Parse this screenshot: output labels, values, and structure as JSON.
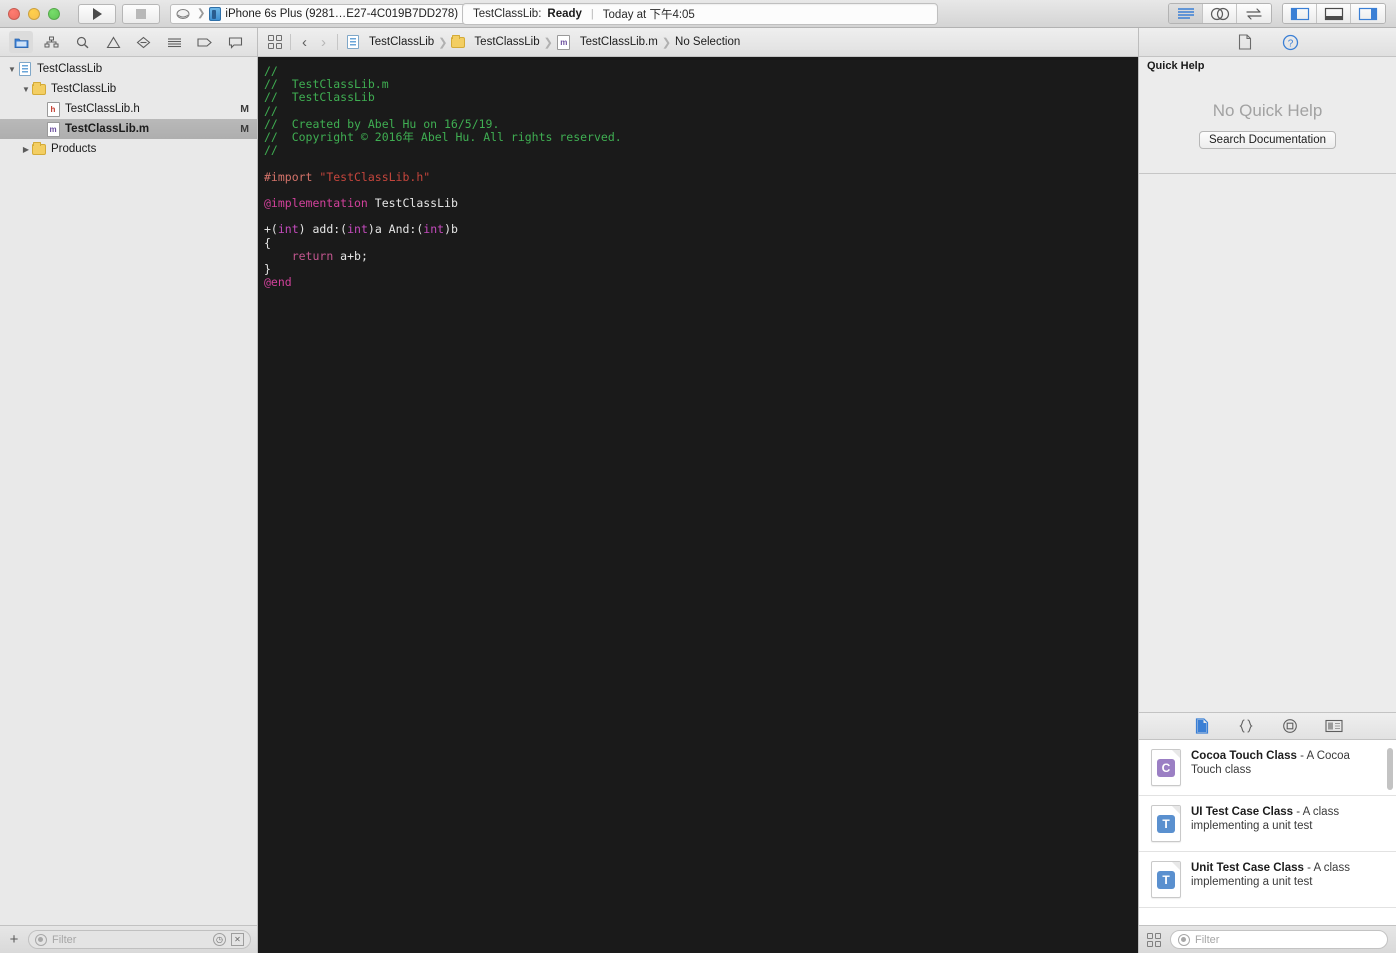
{
  "window": {
    "traffic_lights": [
      "close",
      "minimize",
      "zoom"
    ]
  },
  "toolbar": {
    "run_label": "Run",
    "stop_label": "Stop",
    "scheme": {
      "target": "TestClassLib",
      "destination": "iPhone 6s Plus (9281…E27-4C019B7DD278)"
    },
    "status": {
      "project": "TestClassLib:",
      "state": "Ready",
      "separator": "|",
      "time": "Today at 下午4:05"
    },
    "editor_modes": [
      {
        "name": "standard-editor",
        "selected": true
      },
      {
        "name": "assistant-editor",
        "selected": false
      },
      {
        "name": "version-editor",
        "selected": false
      }
    ],
    "view_toggles": [
      {
        "name": "navigator-toggle",
        "selected": true
      },
      {
        "name": "debug-area-toggle",
        "selected": false
      },
      {
        "name": "utilities-toggle",
        "selected": true
      }
    ]
  },
  "navigator": {
    "tabs": [
      {
        "name": "project-navigator",
        "icon": "folder-icon",
        "selected": true
      },
      {
        "name": "symbol-navigator",
        "icon": "hierarchy-icon",
        "selected": false
      },
      {
        "name": "find-navigator",
        "icon": "search-icon",
        "selected": false
      },
      {
        "name": "issue-navigator",
        "icon": "warning-triangle-icon",
        "selected": false
      },
      {
        "name": "test-navigator",
        "icon": "diamond-icon",
        "selected": false
      },
      {
        "name": "debug-navigator",
        "icon": "lines-icon",
        "selected": false
      },
      {
        "name": "breakpoint-navigator",
        "icon": "tag-icon",
        "selected": false
      },
      {
        "name": "report-navigator",
        "icon": "speech-bubble-icon",
        "selected": false
      }
    ],
    "tree": [
      {
        "label": "TestClassLib",
        "icon": "project-icon",
        "indent": 0,
        "disclosure": "open",
        "badge": "",
        "selected": false
      },
      {
        "label": "TestClassLib",
        "icon": "folder-icon",
        "indent": 1,
        "disclosure": "open",
        "badge": "",
        "selected": false
      },
      {
        "label": "TestClassLib.h",
        "icon": "header-file-icon",
        "indent": 2,
        "disclosure": "none",
        "badge": "M",
        "selected": false
      },
      {
        "label": "TestClassLib.m",
        "icon": "implementation-file-icon",
        "indent": 2,
        "disclosure": "none",
        "badge": "M",
        "selected": true
      },
      {
        "label": "Products",
        "icon": "folder-icon",
        "indent": 1,
        "disclosure": "closed",
        "badge": "",
        "selected": false
      }
    ],
    "bottom": {
      "add_label": "+",
      "filter_placeholder": "Filter",
      "recent_icon": "clock-icon",
      "source_control_icon": "crossed-box-icon"
    }
  },
  "editor": {
    "jumpbar": {
      "related_items_icon": "grid-icon",
      "back_label": "‹",
      "forward_label": "›",
      "breadcrumbs": [
        {
          "label": "TestClassLib",
          "icon": "project-icon"
        },
        {
          "label": "TestClassLib",
          "icon": "folder-icon"
        },
        {
          "label": "TestClassLib.m",
          "icon": "implementation-file-icon"
        },
        {
          "label": "No Selection",
          "icon": ""
        }
      ]
    },
    "code_lines": [
      [
        {
          "t": "//",
          "c": "cm"
        }
      ],
      [
        {
          "t": "//  TestClassLib.m",
          "c": "cm"
        }
      ],
      [
        {
          "t": "//  TestClassLib",
          "c": "cm"
        }
      ],
      [
        {
          "t": "//",
          "c": "cm"
        }
      ],
      [
        {
          "t": "//  Created by Abel Hu on 16/5/19.",
          "c": "cm"
        }
      ],
      [
        {
          "t": "//  Copyright © 2016年 Abel Hu. All rights reserved.",
          "c": "cm"
        }
      ],
      [
        {
          "t": "//",
          "c": "cm"
        }
      ],
      [
        {
          "t": "",
          "c": "id"
        }
      ],
      [
        {
          "t": "#import ",
          "c": "pp"
        },
        {
          "t": "\"TestClassLib.h\"",
          "c": "str"
        }
      ],
      [
        {
          "t": "",
          "c": "id"
        }
      ],
      [
        {
          "t": "@implementation",
          "c": "kw"
        },
        {
          "t": " TestClassLib",
          "c": "id"
        }
      ],
      [
        {
          "t": "",
          "c": "id"
        }
      ],
      [
        {
          "t": "+(",
          "c": "id"
        },
        {
          "t": "int",
          "c": "typ"
        },
        {
          "t": ") add:(",
          "c": "id"
        },
        {
          "t": "int",
          "c": "typ"
        },
        {
          "t": ")a And:(",
          "c": "id"
        },
        {
          "t": "int",
          "c": "typ"
        },
        {
          "t": ")b",
          "c": "id"
        }
      ],
      [
        {
          "t": "{",
          "c": "id"
        }
      ],
      [
        {
          "t": "    ",
          "c": "id"
        },
        {
          "t": "return",
          "c": "ret"
        },
        {
          "t": " a+b;",
          "c": "id"
        }
      ],
      [
        {
          "t": "}",
          "c": "id"
        }
      ],
      [
        {
          "t": "@end",
          "c": "kw"
        }
      ]
    ]
  },
  "utilities": {
    "tabs": [
      {
        "name": "file-inspector",
        "icon": "document-icon",
        "selected": false
      },
      {
        "name": "quick-help-inspector",
        "icon": "question-circle-icon",
        "selected": true
      }
    ],
    "quick_help": {
      "header": "Quick Help",
      "empty_text": "No Quick Help",
      "button_label": "Search Documentation"
    },
    "library": {
      "tabs": [
        {
          "name": "file-template-library",
          "icon": "document-icon",
          "selected": true
        },
        {
          "name": "code-snippet-library",
          "icon": "braces-icon",
          "selected": false
        },
        {
          "name": "object-library",
          "icon": "circle-target-icon",
          "selected": false
        },
        {
          "name": "media-library",
          "icon": "media-icon",
          "selected": false
        }
      ],
      "items": [
        {
          "title": "Cocoa Touch Class",
          "desc": " - A Cocoa Touch class",
          "badge": "C",
          "badge_color": "#9b7fc4"
        },
        {
          "title": "UI Test Case Class",
          "desc": " - A class implementing a unit test",
          "badge": "T",
          "badge_color": "#5a90cf"
        },
        {
          "title": "Unit Test Case Class",
          "desc": " - A class implementing a unit test",
          "badge": "T",
          "badge_color": "#5a90cf"
        }
      ],
      "bottom": {
        "layout_icon": "grid-icon",
        "filter_placeholder": "Filter"
      }
    }
  },
  "colors": {
    "editor_background": "#1a1a1a",
    "comment": "#3fae52",
    "preprocessor": "#d4736a",
    "string": "#c4453c",
    "keyword": "#d1419b",
    "type": "#c44bbd",
    "accent_blue": "#3a7fd5"
  }
}
